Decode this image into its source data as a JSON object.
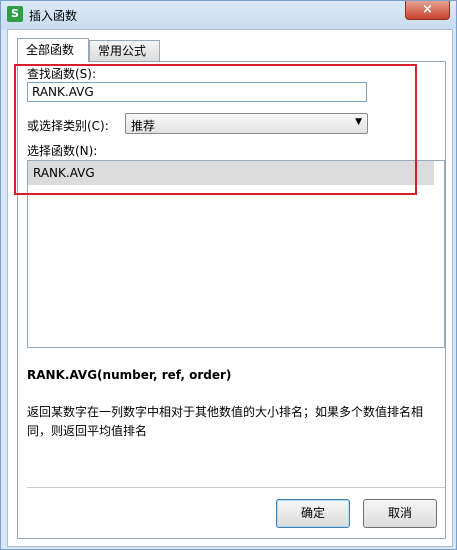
{
  "window": {
    "title": "插入函数",
    "app_icon_letter": "S",
    "close_label": "×"
  },
  "tabs": [
    {
      "label": "全部函数",
      "active": true
    },
    {
      "label": "常用公式",
      "active": false
    }
  ],
  "search": {
    "label": "查找函数(S):",
    "value": "RANK.AVG"
  },
  "category": {
    "label": "或选择类别(C):",
    "value": "推荐"
  },
  "function_list": {
    "label": "选择函数(N):",
    "items": [
      "RANK.AVG"
    ]
  },
  "signature": "RANK.AVG(number, ref, order)",
  "description": "返回某数字在一列数字中相对于其他数值的大小排名；如果多个数值排名相同，则返回平均值排名",
  "buttons": {
    "ok": "确定",
    "cancel": "取消"
  },
  "colors": {
    "highlight_border": "#d81e2c",
    "titlebar": "#d7e6f6"
  }
}
